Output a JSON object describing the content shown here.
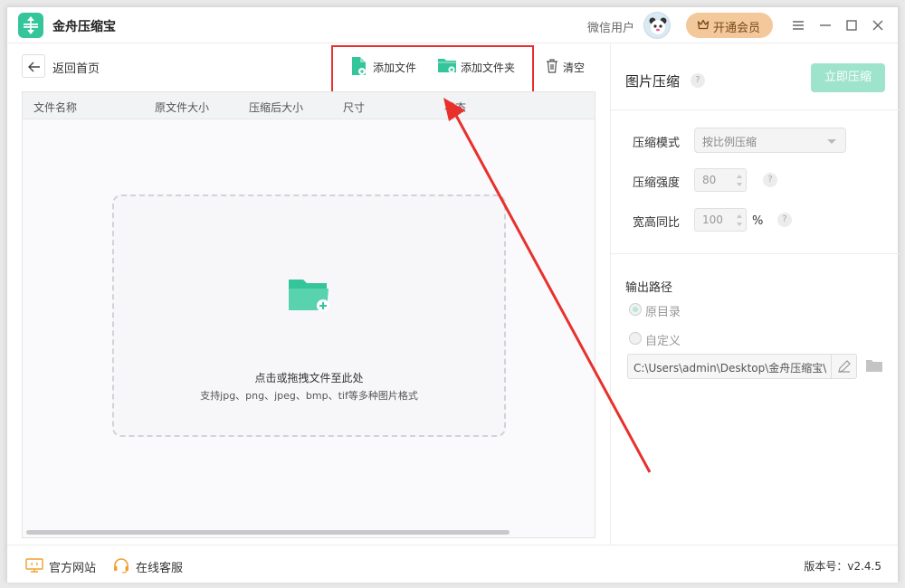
{
  "app": {
    "title": "金舟压缩宝",
    "user_name": "微信用户",
    "vip_label": "开通会员"
  },
  "toolbar": {
    "back_label": "返回首页",
    "add_file": "添加文件",
    "add_folder": "添加文件夹",
    "clear": "清空"
  },
  "table": {
    "columns": [
      "文件名称",
      "原文件大小",
      "压缩后大小",
      "尺寸",
      "状态"
    ]
  },
  "dropzone": {
    "main": "点击或拖拽文件至此处",
    "sub": "支持jpg、png、jpeg、bmp、tif等多种图片格式"
  },
  "panel": {
    "title": "图片压缩",
    "help": "?",
    "compress_button": "立即压缩",
    "mode_label": "压缩模式",
    "mode_value": "按比例压缩",
    "strength_label": "压缩强度",
    "strength_value": "80",
    "ratio_label": "宽高同比",
    "ratio_value": "100",
    "ratio_unit": "%",
    "output_title": "输出路径",
    "option_original": "原目录",
    "option_custom": "自定义",
    "path": "C:\\Users\\admin\\Desktop\\金舟压缩宝\\"
  },
  "footer": {
    "website": "官方网站",
    "support": "在线客服",
    "version": "版本号：v2.4.5"
  },
  "colors": {
    "accent": "#35c59a",
    "annotation": "#e8302c",
    "vip": "#f3c89b"
  }
}
